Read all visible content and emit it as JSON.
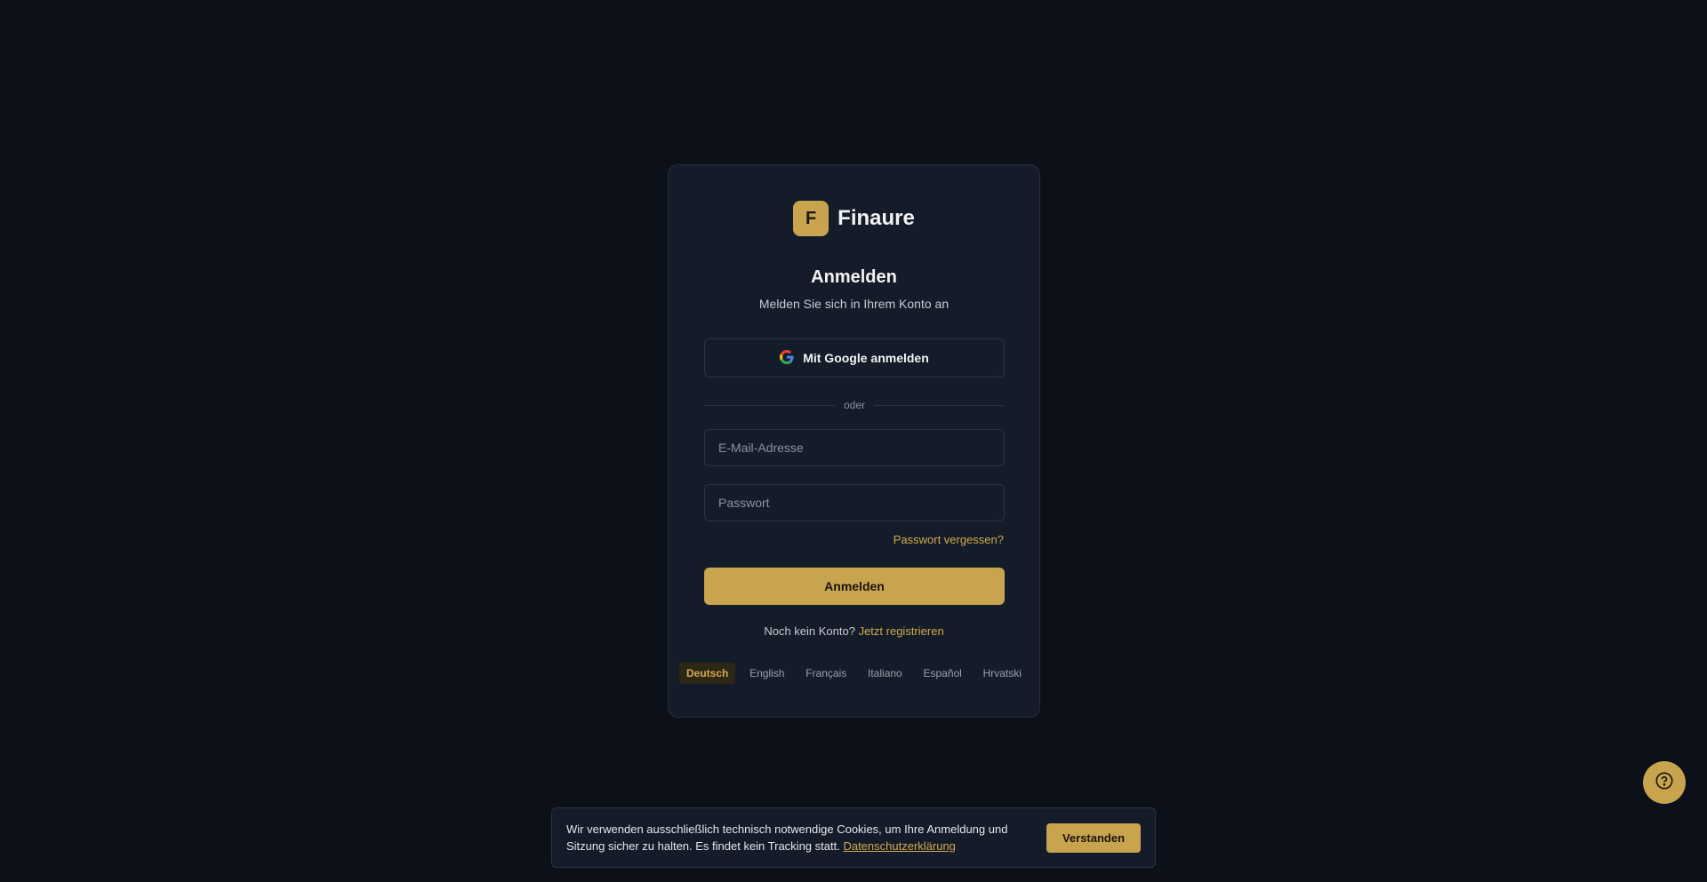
{
  "brand": {
    "badge_letter": "F",
    "name": "Finaure"
  },
  "login": {
    "title": "Anmelden",
    "subtitle": "Melden Sie sich in Ihrem Konto an",
    "google_button": "Mit Google anmelden",
    "divider": "oder",
    "email_placeholder": "E-Mail-Adresse",
    "password_placeholder": "Passwort",
    "forgot_link": "Passwort vergessen?",
    "submit_button": "Anmelden",
    "no_account": "Noch kein Konto?",
    "register_link": "Jetzt registrieren"
  },
  "languages": [
    {
      "label": "Deutsch",
      "active": true
    },
    {
      "label": "English",
      "active": false
    },
    {
      "label": "Français",
      "active": false
    },
    {
      "label": "Italiano",
      "active": false
    },
    {
      "label": "Español",
      "active": false
    },
    {
      "label": "Hrvatski",
      "active": false
    }
  ],
  "help": {
    "icon": "help-circle-icon"
  },
  "cookie": {
    "text": "Wir verwenden ausschließlich technisch notwendige Cookies, um Ihre Anmeldung und Sitzung sicher zu halten. Es findet kein Tracking statt.",
    "privacy_link": "Datenschutzerklärung",
    "button": "Verstanden"
  },
  "colors": {
    "background": "#0b1019",
    "card": "#131c28",
    "accent": "#c9a44e",
    "link": "#d4a94e"
  }
}
